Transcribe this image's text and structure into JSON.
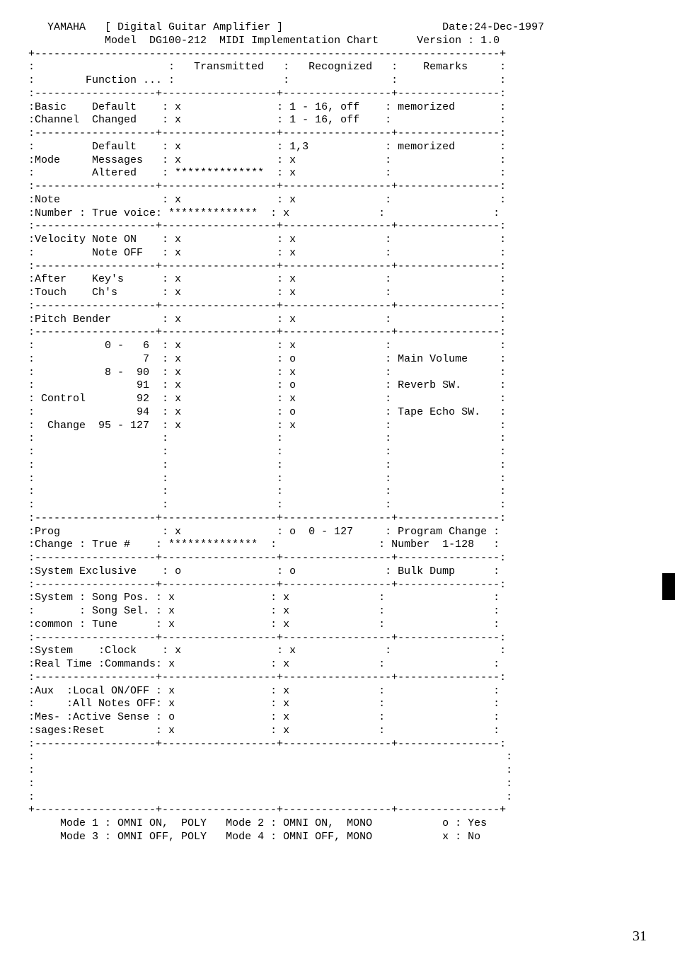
{
  "header": {
    "brand": "YAMAHA",
    "title": "[ Digital Guitar Amplifier ]",
    "model_line": "Model  DG100-212  MIDI Implementation Chart",
    "date_label": "Date:24-Dec-1997",
    "version_label": "Version : 1.0"
  },
  "columns": {
    "function": "Function ...",
    "transmitted": "Transmitted",
    "recognized": "Recognized",
    "remarks": "Remarks"
  },
  "rows": {
    "basic_channel": {
      "group": "Basic\nChannel",
      "default": {
        "label": "Default",
        "tx": "x",
        "rx": "1 - 16, off",
        "rem": "memorized"
      },
      "changed": {
        "label": "Changed",
        "tx": "x",
        "rx": "1 - 16, off",
        "rem": ""
      }
    },
    "mode": {
      "group": "Mode",
      "default": {
        "label": "Default",
        "tx": "x",
        "rx": "1,3",
        "rem": "memorized"
      },
      "messages": {
        "label": "Messages",
        "tx": "x",
        "rx": "x",
        "rem": ""
      },
      "altered": {
        "label": "Altered",
        "tx": "**************",
        "rx": "x",
        "rem": ""
      }
    },
    "note_number": {
      "group": "Note\nNumber",
      "note": {
        "label": "",
        "tx": "x",
        "rx": "x",
        "rem": ""
      },
      "true_voice": {
        "label": "True voice",
        "tx": "**************",
        "rx": "x",
        "rem": ""
      }
    },
    "velocity": {
      "group": "Velocity",
      "note_on": {
        "label": "Note ON",
        "tx": "x",
        "rx": "x",
        "rem": ""
      },
      "note_off": {
        "label": "Note OFF",
        "tx": "x",
        "rx": "x",
        "rem": ""
      }
    },
    "after_touch": {
      "group": "After\nTouch",
      "keys": {
        "label": "Key's",
        "tx": "x",
        "rx": "x",
        "rem": ""
      },
      "chs": {
        "label": "Ch's",
        "tx": "x",
        "rx": "x",
        "rem": ""
      }
    },
    "pitch_bender": {
      "label": "Pitch Bender",
      "tx": "x",
      "rx": "x",
      "rem": ""
    },
    "control_change": {
      "group": "Control\n\nChange",
      "items": [
        {
          "range": "0 -   6",
          "tx": "x",
          "rx": "x",
          "rem": ""
        },
        {
          "range": "7",
          "tx": "x",
          "rx": "o",
          "rem": "Main Volume"
        },
        {
          "range": "8 -  90",
          "tx": "x",
          "rx": "x",
          "rem": ""
        },
        {
          "range": "91",
          "tx": "x",
          "rx": "o",
          "rem": "Reverb SW."
        },
        {
          "range": "92",
          "tx": "x",
          "rx": "x",
          "rem": ""
        },
        {
          "range": "94",
          "tx": "x",
          "rx": "o",
          "rem": "Tape Echo SW."
        },
        {
          "range": "95 - 127",
          "tx": "x",
          "rx": "x",
          "rem": ""
        }
      ]
    },
    "prog_change": {
      "group": "Prog\nChange",
      "top": {
        "label": "",
        "tx": "x",
        "rx": "o  0 - 127",
        "rem": "Program Change"
      },
      "true_n": {
        "label": "True #",
        "tx": "**************",
        "rx": "",
        "rem": "Number  1-128"
      }
    },
    "system_exclusive": {
      "label": "System Exclusive",
      "tx": "o",
      "rx": "o",
      "rem": "Bulk Dump"
    },
    "system_common": {
      "group": "System\n\ncommon",
      "song_pos": {
        "label": "Song Pos.",
        "tx": "x",
        "rx": "x",
        "rem": ""
      },
      "song_sel": {
        "label": "Song Sel.",
        "tx": "x",
        "rx": "x",
        "rem": ""
      },
      "tune": {
        "label": "Tune",
        "tx": "x",
        "rx": "x",
        "rem": ""
      }
    },
    "system_realtime": {
      "group": "System\nReal Time",
      "clock": {
        "label": "Clock",
        "tx": "x",
        "rx": "x",
        "rem": ""
      },
      "commands": {
        "label": "Commands",
        "tx": "x",
        "rx": "x",
        "rem": ""
      }
    },
    "aux_messages": {
      "group": "Aux\n\nMes-\nsages",
      "local": {
        "label": "Local ON/OFF",
        "tx": "x",
        "rx": "x",
        "rem": ""
      },
      "notesoff": {
        "label": "All Notes OFF",
        "tx": "x",
        "rx": "x",
        "rem": ""
      },
      "active": {
        "label": "Active Sense",
        "tx": "o",
        "rx": "x",
        "rem": ""
      },
      "reset": {
        "label": "Reset",
        "tx": "x",
        "rx": "x",
        "rem": ""
      }
    }
  },
  "footer": {
    "mode1": "Mode 1 : OMNI ON,  POLY",
    "mode2": "Mode 2 : OMNI ON,  MONO",
    "mode3": "Mode 3 : OMNI OFF, POLY",
    "mode4": "Mode 4 : OMNI OFF, MONO",
    "yes": "o : Yes",
    "no": "x : No"
  },
  "page_number": "31"
}
